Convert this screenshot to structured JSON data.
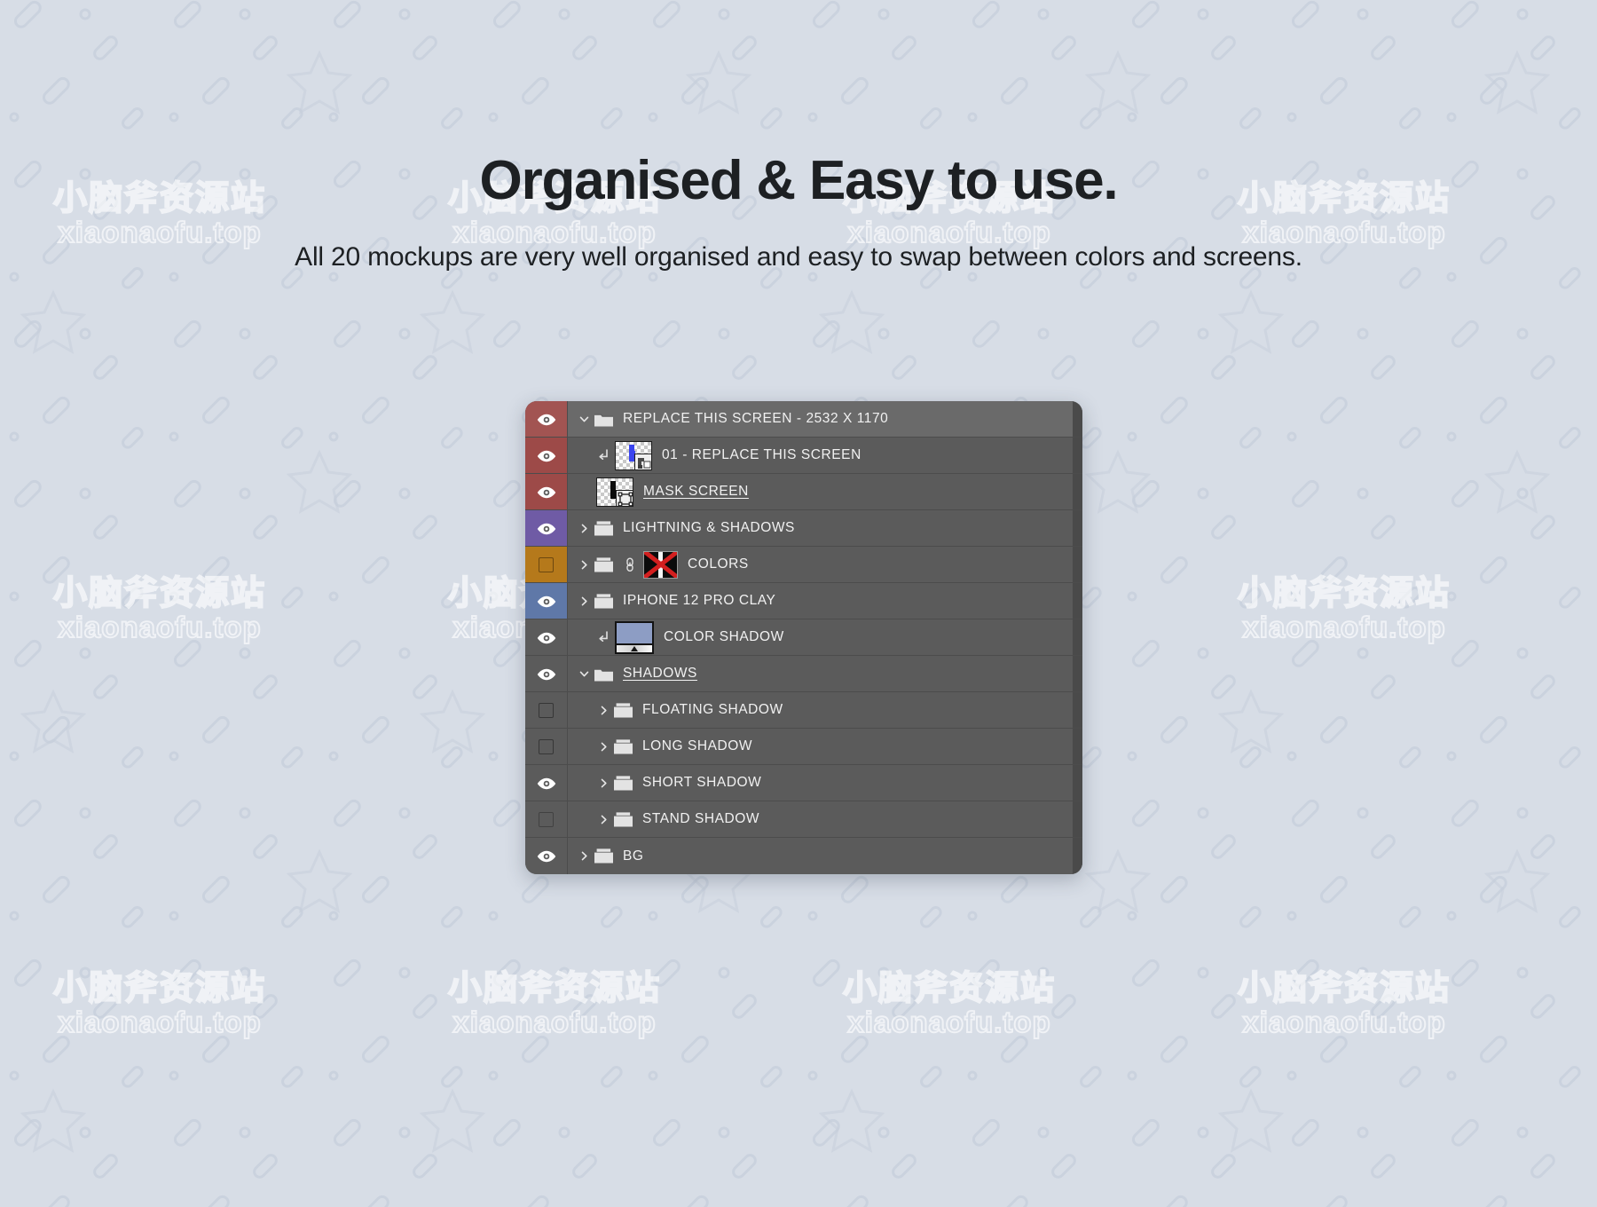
{
  "header": {
    "title": "Organised & Easy to use.",
    "subtitle": "All 20 mockups are very well organised and easy to swap between colors and screens."
  },
  "watermark": {
    "cn": "小脑斧资源站",
    "en": "xiaonaofu.top"
  },
  "colors": {
    "background": "#d7dde6",
    "panel": "#5b5b5b",
    "panel_selected": "#6a6a6a",
    "panel_edge": "#4a4a4a",
    "row_divider": "#4c4c4c",
    "label_red": "#9d4a48",
    "label_purple": "#6f5ba5",
    "label_orange": "#b5791b",
    "label_blue": "#5f78a8",
    "label_none": "#5b5b5b",
    "text": "#f1f1f1",
    "heading": "#1d2023",
    "mask_x": "#d31f1f",
    "thumb_blue": "#3b45ef",
    "gradmap_fill": "#8d9dc4"
  },
  "panel": {
    "name": "Layers panel",
    "rows": [
      {
        "label": "REPLACE THIS SCREEN - 2532 X 1170",
        "color_label": "red",
        "visible": true,
        "selected": true,
        "indent": 1,
        "twisty": "expanded",
        "icon": "folder-open-icon",
        "thumb": "none",
        "underline": false
      },
      {
        "label": "01 - REPLACE THIS SCREEN",
        "color_label": "red",
        "visible": true,
        "selected": false,
        "indent": 2,
        "twisty": "none",
        "icon": "clipping-mask-arrow-icon",
        "thumb": "smart-object",
        "underline": false
      },
      {
        "label": "MASK SCREEN",
        "color_label": "red",
        "visible": true,
        "selected": false,
        "indent": 2,
        "twisty": "none",
        "icon": "none",
        "thumb": "shape-layer",
        "underline": true
      },
      {
        "label": "LIGHTNING & SHADOWS",
        "color_label": "purple",
        "visible": true,
        "selected": false,
        "indent": 1,
        "twisty": "collapsed",
        "icon": "folder-closed-icon",
        "thumb": "none",
        "underline": false
      },
      {
        "label": "COLORS",
        "color_label": "orange",
        "visible": false,
        "selected": false,
        "indent": 1,
        "twisty": "collapsed",
        "icon": "folder-closed-icon",
        "thumb": "disabled-mask",
        "underline": false
      },
      {
        "label": "IPHONE 12 PRO CLAY",
        "color_label": "blue",
        "visible": true,
        "selected": false,
        "indent": 1,
        "twisty": "collapsed",
        "icon": "folder-closed-icon",
        "thumb": "none",
        "underline": false
      },
      {
        "label": "COLOR SHADOW",
        "color_label": "none",
        "visible": true,
        "selected": false,
        "indent": 2,
        "twisty": "none",
        "icon": "clipping-mask-arrow-icon",
        "thumb": "gradient-map",
        "underline": false
      },
      {
        "label": "SHADOWS",
        "color_label": "none",
        "visible": true,
        "selected": false,
        "indent": 1,
        "twisty": "expanded",
        "icon": "folder-open-icon",
        "thumb": "none",
        "underline": true
      },
      {
        "label": "FLOATING SHADOW",
        "color_label": "none",
        "visible": false,
        "selected": false,
        "indent": 2,
        "twisty": "collapsed",
        "icon": "folder-closed-icon",
        "thumb": "none",
        "underline": false
      },
      {
        "label": "LONG SHADOW",
        "color_label": "none",
        "visible": false,
        "selected": false,
        "indent": 2,
        "twisty": "collapsed",
        "icon": "folder-closed-icon",
        "thumb": "none",
        "underline": false
      },
      {
        "label": "SHORT SHADOW",
        "color_label": "none",
        "visible": true,
        "selected": false,
        "indent": 2,
        "twisty": "collapsed",
        "icon": "folder-closed-icon",
        "thumb": "none",
        "underline": false
      },
      {
        "label": "STAND SHADOW",
        "color_label": "none",
        "visible": false,
        "selected": false,
        "indent": 2,
        "twisty": "collapsed",
        "icon": "folder-closed-icon",
        "thumb": "none",
        "underline": false
      },
      {
        "label": "BG",
        "color_label": "none",
        "visible": true,
        "selected": false,
        "indent": 1,
        "twisty": "collapsed",
        "icon": "folder-closed-icon",
        "thumb": "none",
        "underline": false
      }
    ]
  }
}
